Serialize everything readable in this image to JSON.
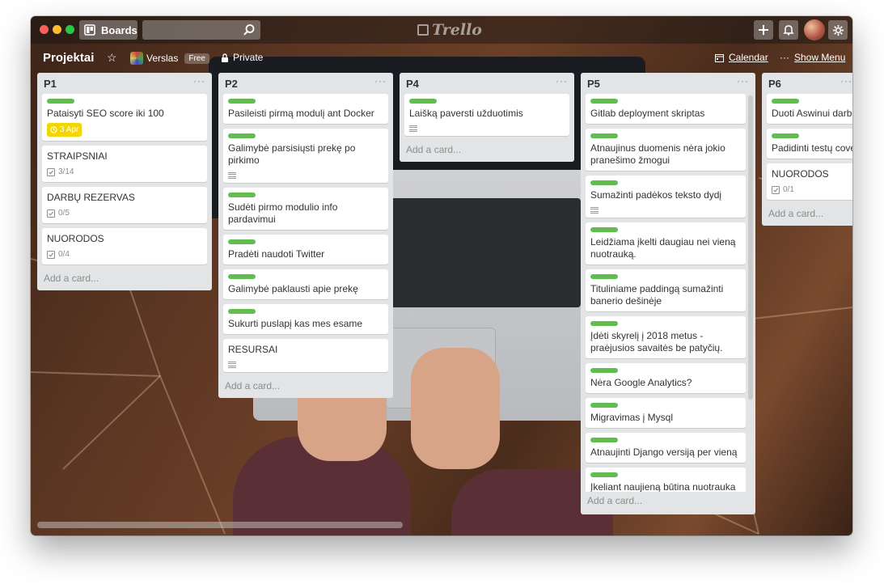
{
  "topbar": {
    "boards_label": "Boards",
    "search_value": "",
    "logo_text": "Trello"
  },
  "board": {
    "title": "Projektai",
    "team_name": "Verslas",
    "team_badge": "Free",
    "visibility": "Private",
    "calendar_label": "Calendar",
    "menu_dots": "···",
    "show_menu_label": "Show Menu"
  },
  "lists": [
    {
      "title": "P1",
      "menu": "···",
      "cards": [
        {
          "text": "Pataisyti SEO score iki 100",
          "label": true,
          "due": "3 Apr"
        },
        {
          "text": "STRAIPSNIAI",
          "label": false,
          "checklist": "3/14"
        },
        {
          "text": "DARBŲ REZERVAS",
          "label": false,
          "checklist": "0/5"
        },
        {
          "text": "NUORODOS",
          "label": false,
          "checklist": "0/4"
        }
      ],
      "add_card": "Add a card..."
    },
    {
      "title": "P2",
      "menu": "···",
      "cards": [
        {
          "text": "Pasileisti pirmą modulį ant Docker",
          "label": true
        },
        {
          "text": "Galimybė parsisiųsti prekę po pirkimo",
          "label": true,
          "desc": true
        },
        {
          "text": "Sudėti pirmo modulio info pardavimui",
          "label": true
        },
        {
          "text": "Pradėti naudoti Twitter",
          "label": true
        },
        {
          "text": "Galimybė paklausti apie prekę",
          "label": true
        },
        {
          "text": "Sukurti puslapį kas mes esame",
          "label": true
        },
        {
          "text": "RESURSAI",
          "label": false,
          "desc": true
        }
      ],
      "add_card": "Add a card..."
    },
    {
      "title": "P4",
      "menu": "···",
      "cards": [
        {
          "text": "Laišką paversti užduotimis",
          "label": true,
          "desc": true
        }
      ],
      "add_card": "Add a card..."
    },
    {
      "title": "P5",
      "menu": "···",
      "cards": [
        {
          "text": "Gitlab deployment skriptas",
          "label": true
        },
        {
          "text": "Atnaujinus duomenis nėra jokio pranešimo žmogui",
          "label": true
        },
        {
          "text": "Sumažinti padėkos teksto dydį",
          "label": true,
          "desc": true
        },
        {
          "text": "Leidžiama įkelti daugiau nei vieną nuotrauką.",
          "label": true
        },
        {
          "text": "Tituliniame paddingą sumažinti banerio dešinėje",
          "label": true
        },
        {
          "text": "Įdėti skyrelį į 2018 metus - praėjusios savaitės be patyčių.",
          "label": true
        },
        {
          "text": "Nėra Google Analytics?",
          "label": true
        },
        {
          "text": "Migravimas į Mysql",
          "label": true
        },
        {
          "text": "Atnaujinti Django versiją per vieną",
          "label": true
        },
        {
          "text": "Įkeliant naujieną būtina nuotrauka",
          "label": true
        }
      ],
      "add_card": "Add a card..."
    },
    {
      "title": "P6",
      "menu": "···",
      "cards": [
        {
          "text": "Duoti Aswinui darbo",
          "label": true
        },
        {
          "text": "Padidinti testų cove",
          "label": true
        },
        {
          "text": "NUORODOS",
          "label": false,
          "checklist": "0/1"
        }
      ],
      "add_card": "Add a card..."
    }
  ],
  "colors": {
    "label_green": "#61bd4f",
    "due_yellow": "#f2d600",
    "list_bg": "#e2e4e6"
  }
}
